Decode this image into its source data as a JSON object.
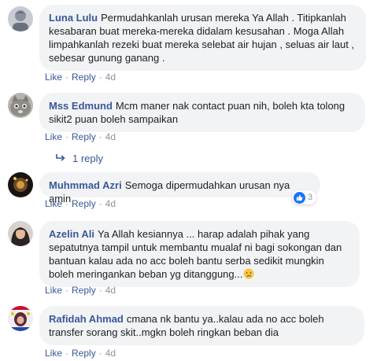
{
  "comments": [
    {
      "author": "Luna Lulu",
      "text": "Permudahkanlah urusan mereka Ya Allah . Titipkanlah kesabaran buat mereka-mereka didalam kesusahan . Moga Allah limpahkanlah rezeki buat mereka selebat air hujan , seluas air laut , sebesar gunung ganang .",
      "like": "Like",
      "reply": "Reply",
      "time": "4d"
    },
    {
      "author": "Mss Edmund",
      "text": "Mcm maner nak contact puan nih, boleh kta tolong sikit2 puan boleh sampaikan",
      "like": "Like",
      "reply": "Reply",
      "time": "4d",
      "replies_link": "1 reply"
    },
    {
      "author": "Muhmmad Azri",
      "text": "Semoga dipermudahkan urusan nya amin",
      "like": "Like",
      "reply": "Reply",
      "time": "4d",
      "reaction_count": "3"
    },
    {
      "author": "Azelin Ali",
      "text": "Ya Allah kesiannya ... harap adalah pihak yang sepatutnya tampil untuk membantu mualaf ni bagi sokongan dan bantuan kalau ada no acc boleh bantu serba sedikit mungkin boleh meringankan beban yg ditanggung...",
      "like": "Like",
      "reply": "Reply",
      "time": "4d",
      "emoji": "crying-face"
    },
    {
      "author": "Rafidah Ahmad",
      "text": "cmana nk bantu ya..kalau ada no acc boleh transfer sorang skit..mgkn boleh ringkan beban dia",
      "like": "Like",
      "reply": "Reply",
      "time": "4d"
    }
  ],
  "colors": {
    "author": "#385898",
    "bubble_bg": "#f2f3f5",
    "meta": "#90949c",
    "like_blue": "#1877f2"
  }
}
